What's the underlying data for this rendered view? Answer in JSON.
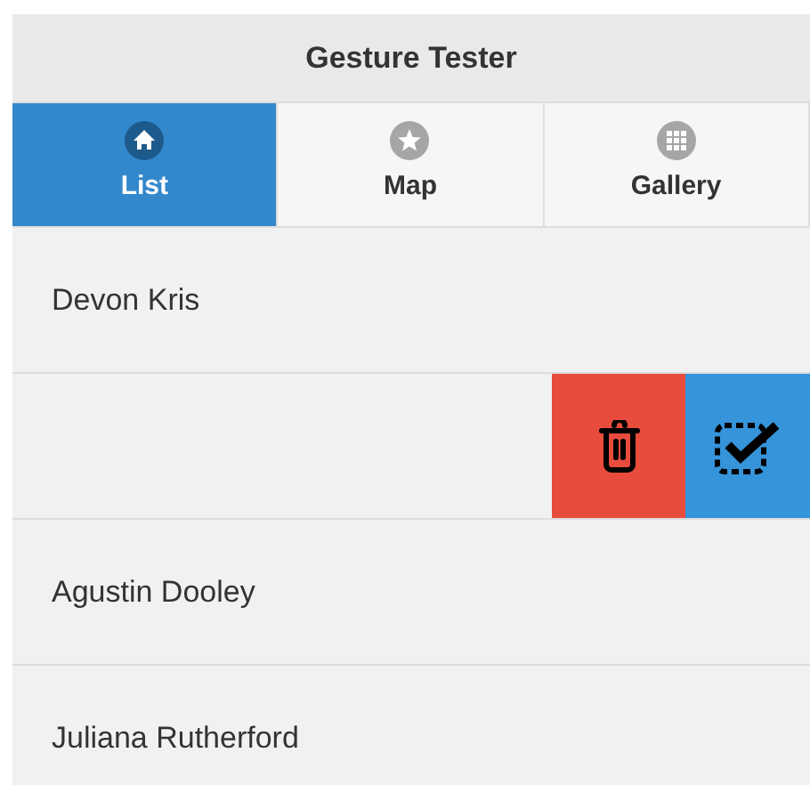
{
  "header": {
    "title": "Gesture Tester"
  },
  "tabs": [
    {
      "label": "List",
      "selected": true
    },
    {
      "label": "Map",
      "selected": false
    },
    {
      "label": "Gallery",
      "selected": false
    }
  ],
  "rows": [
    {
      "kind": "item",
      "name": "Devon Kris"
    },
    {
      "kind": "actions"
    },
    {
      "kind": "item",
      "name": "Agustin Dooley"
    },
    {
      "kind": "item",
      "name": "Juliana Rutherford"
    }
  ]
}
